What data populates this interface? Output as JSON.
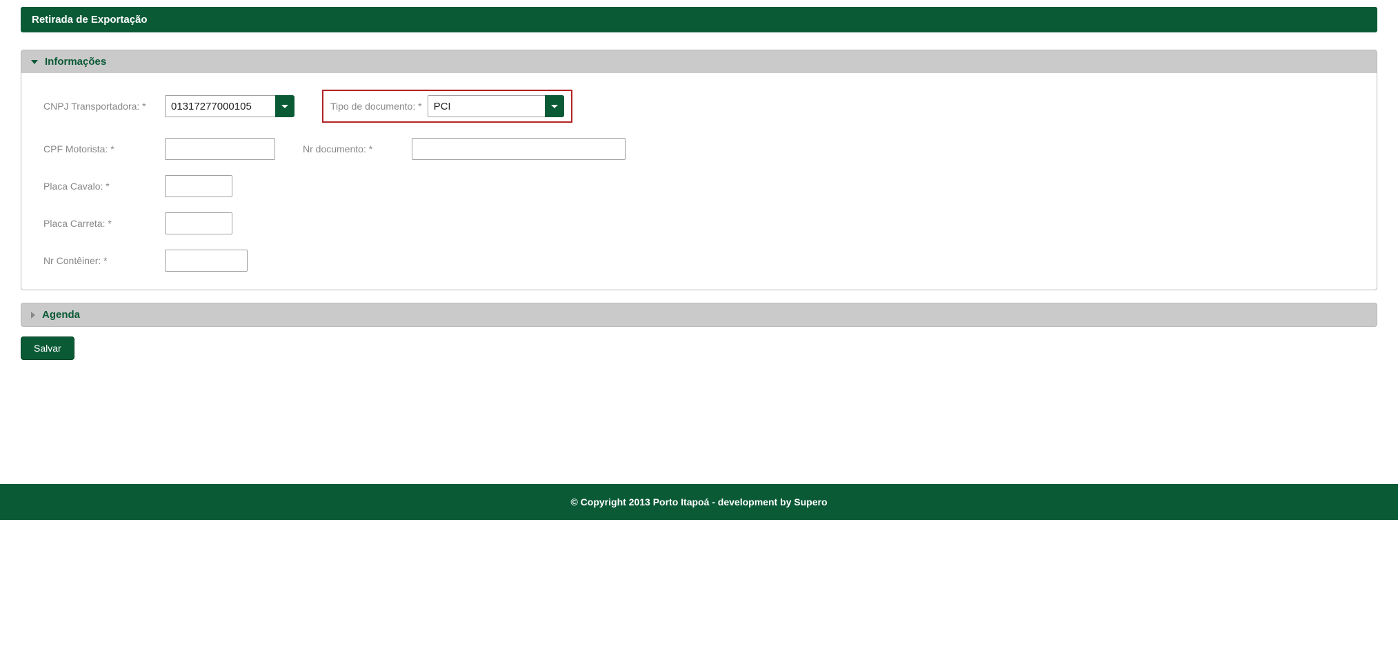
{
  "header": {
    "title": "Retirada de Exportação"
  },
  "sections": {
    "info": {
      "title": "Informações"
    },
    "agenda": {
      "title": "Agenda"
    }
  },
  "fields": {
    "cnpj": {
      "label": "CNPJ Transportadora: *",
      "value": "01317277000105"
    },
    "tipo_doc": {
      "label": "Tipo de documento: *",
      "value": "PCI"
    },
    "cpf_motorista": {
      "label": "CPF Motorista: *",
      "value": ""
    },
    "nr_documento": {
      "label": "Nr documento: *",
      "value": ""
    },
    "placa_cavalo": {
      "label": "Placa Cavalo: *",
      "value": ""
    },
    "placa_carreta": {
      "label": "Placa Carreta: *",
      "value": ""
    },
    "nr_conteiner": {
      "label": "Nr Contêiner: *",
      "value": ""
    }
  },
  "buttons": {
    "salvar": "Salvar"
  },
  "footer": {
    "text": "© Copyright 2013 Porto Itapoá - development by Supero"
  }
}
